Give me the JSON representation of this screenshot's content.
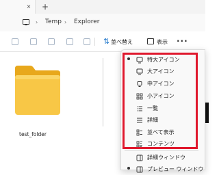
{
  "tabs": {
    "new_tab_symbol": "+",
    "close_symbol": "×"
  },
  "address": {
    "separator": "›",
    "crumbs": [
      "Temp",
      "Explorer"
    ]
  },
  "toolbar": {
    "sort_label": "並べ替え",
    "view_label": "表示",
    "more_label": "···",
    "dropdown_chevron": "⌄"
  },
  "content": {
    "folder_name": "test_folder"
  },
  "view_menu": {
    "items": [
      {
        "label": "特大アイコン",
        "icon": "monitor-icon",
        "selected": true
      },
      {
        "label": "大アイコン",
        "icon": "monitor-icon",
        "selected": false
      },
      {
        "label": "中アイコン",
        "icon": "monitor-icon",
        "selected": false
      },
      {
        "label": "小アイコン",
        "icon": "grid-icon",
        "selected": false
      },
      {
        "label": "一覧",
        "icon": "list-icon",
        "selected": false
      },
      {
        "label": "詳細",
        "icon": "details-icon",
        "selected": false
      },
      {
        "label": "並べて表示",
        "icon": "tiles-icon",
        "selected": false
      },
      {
        "label": "コンテンツ",
        "icon": "content-icon",
        "selected": false
      }
    ],
    "extra_items": [
      {
        "label": "詳細ウィンドウ",
        "icon": "panel-icon"
      },
      {
        "label": "プレビュー ウィンドウ",
        "icon": "panel-icon"
      }
    ]
  },
  "colors": {
    "highlight": "#e0182d",
    "folder": "#f5c542",
    "accent": "#1a73c9"
  }
}
